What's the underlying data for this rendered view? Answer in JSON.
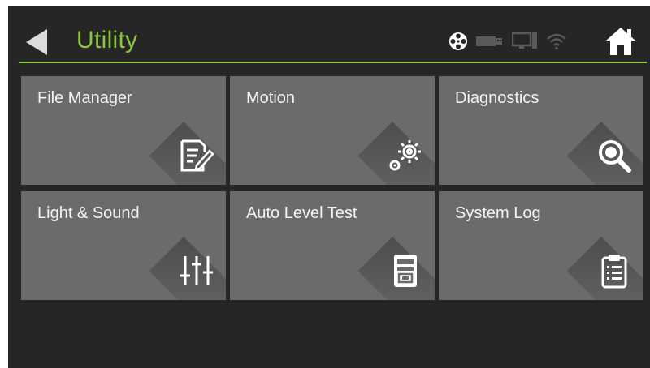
{
  "header": {
    "title": "Utility",
    "accent_color": "#8cc63f",
    "back_icon": "back-arrow-icon",
    "home_icon": "home-icon",
    "status_icons": [
      "film-reel-icon",
      "usb-drive-icon",
      "monitor-icon",
      "wifi-icon"
    ]
  },
  "tiles": [
    {
      "label": "File Manager",
      "icon": "edit-document-icon"
    },
    {
      "label": "Motion",
      "icon": "gears-icon"
    },
    {
      "label": "Diagnostics",
      "icon": "magnifier-icon"
    },
    {
      "label": "Light & Sound",
      "icon": "sliders-icon"
    },
    {
      "label": "Auto Level Test",
      "icon": "printer-bed-icon"
    },
    {
      "label": "System Log",
      "icon": "clipboard-list-icon"
    }
  ],
  "colors": {
    "background": "#262626",
    "tile": "#6b6b6b",
    "tile_text": "#f2f2f2",
    "icon": "#ffffff"
  }
}
